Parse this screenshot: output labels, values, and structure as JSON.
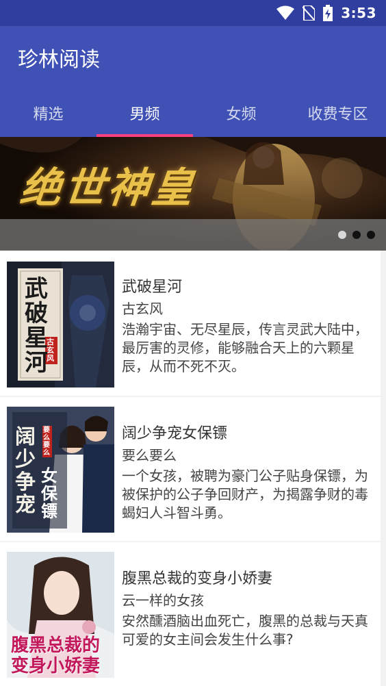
{
  "status_bar": {
    "time": "3:53",
    "icons": [
      "wifi-icon",
      "no-sim-icon",
      "battery-charging-icon"
    ]
  },
  "app": {
    "title": "珍林阅读"
  },
  "tabs": [
    {
      "label": "精选",
      "active": false
    },
    {
      "label": "男频",
      "active": true
    },
    {
      "label": "女频",
      "active": false
    },
    {
      "label": "收费专区",
      "active": false
    }
  ],
  "banner": {
    "title": "绝世神皇",
    "page_count": 3,
    "active_index": 0
  },
  "books": [
    {
      "title": "武破星河",
      "author": "古玄风",
      "description": "浩瀚宇宙、无尽星辰，传言灵武大陆中，最厉害的灵修，能够融合天上的六颗星辰，从而不死不灭。",
      "cover_text": "武破星河",
      "cover_tag": "古玄风"
    },
    {
      "title": "阔少争宠女保镖",
      "author": "要么要么",
      "description": "一个女孩，被聘为豪门公子贴身保镖，为被保护的公子争回财产，为揭露争财的毒蝎妇人斗智斗勇。",
      "cover_text": "阔少争宠",
      "cover_text2": "女保镖",
      "cover_tag": "要么要么"
    },
    {
      "title": "腹黑总裁的变身小娇妻",
      "author": "云一样的女孩",
      "description": "安然醺酒脑出血死亡，腹黑的总裁与天真可爱的女主间会发生什么事?",
      "cover_text": "腹黑总裁的",
      "cover_text2": "变身小娇妻"
    }
  ]
}
